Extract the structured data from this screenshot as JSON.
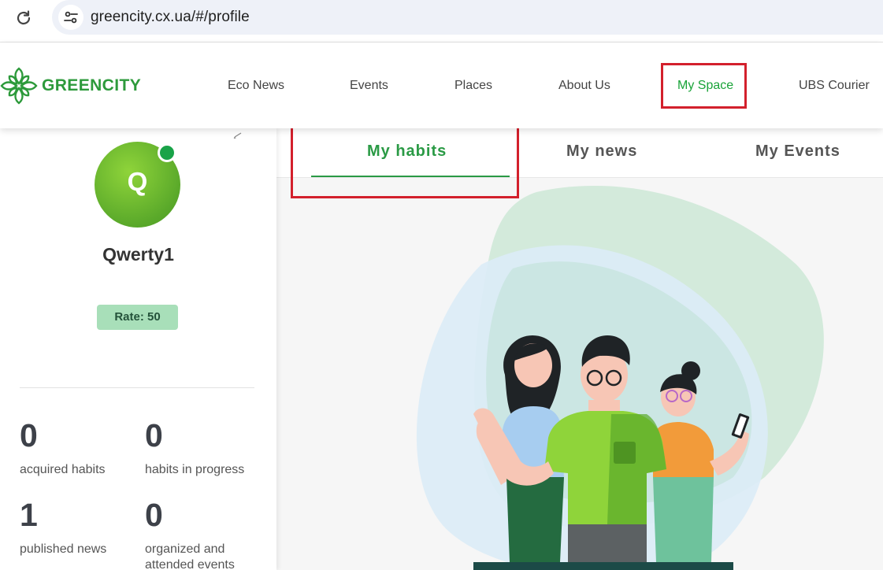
{
  "browser": {
    "url": "greencity.cx.ua/#/profile"
  },
  "header": {
    "logo_text": "GREENCITY",
    "nav": [
      {
        "label": "Eco News"
      },
      {
        "label": "Events"
      },
      {
        "label": "Places"
      },
      {
        "label": "About Us"
      },
      {
        "label": "My Space",
        "active": true
      },
      {
        "label": "UBS Courier"
      }
    ]
  },
  "profile": {
    "avatar_letter": "Q",
    "username": "Qwerty1",
    "rate": "Rate: 50",
    "stats": [
      {
        "value": "0",
        "label": "acquired habits"
      },
      {
        "value": "0",
        "label": "habits in progress"
      },
      {
        "value": "1",
        "label": "published news"
      },
      {
        "value": "0",
        "label": "organized and attended events"
      }
    ]
  },
  "tabs": [
    {
      "label": "My habits",
      "active": true
    },
    {
      "label": "My news"
    },
    {
      "label": "My Events"
    }
  ],
  "icons": {
    "reload": "reload-icon",
    "site_info": "site-info-icon",
    "logo": "greencity-leaf-logo-icon",
    "edit": "edit-pencil-icon"
  },
  "colors": {
    "brand_green": "#2d9a3b",
    "active_nav": "#19a338",
    "highlight_red": "#d3202c",
    "rate_badge": "#a8dfb9"
  }
}
